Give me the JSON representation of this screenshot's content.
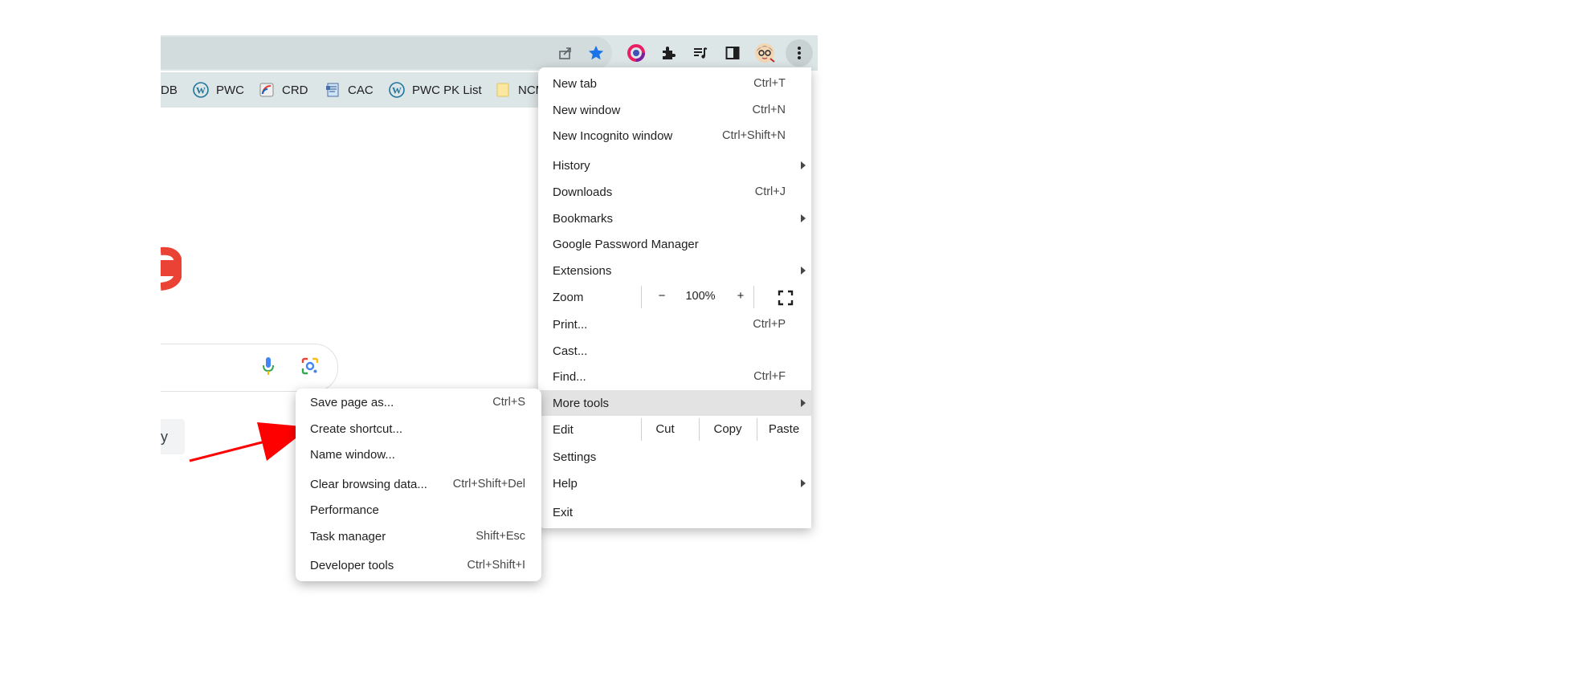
{
  "toolbar": {
    "icons": [
      "share-icon",
      "bookmark-star-icon",
      "color-extension-icon",
      "extensions-puzzle-icon",
      "reading-list-icon",
      "side-panel-icon",
      "profile-avatar",
      "kebab-menu-icon"
    ]
  },
  "bookmarks": [
    {
      "label": "DB",
      "icon": "none"
    },
    {
      "label": "PWC",
      "icon": "wordpress-icon"
    },
    {
      "label": "CRD",
      "icon": "rss-icon"
    },
    {
      "label": "CAC",
      "icon": "document-icon"
    },
    {
      "label": "PWC PK List",
      "icon": "wordpress-icon"
    },
    {
      "label": "NCM",
      "icon": "folder-icon"
    }
  ],
  "page": {
    "button_fragment": "y"
  },
  "menu": {
    "new_tab": {
      "label": "New tab",
      "shortcut": "Ctrl+T"
    },
    "new_window": {
      "label": "New window",
      "shortcut": "Ctrl+N"
    },
    "new_incognito": {
      "label": "New Incognito window",
      "shortcut": "Ctrl+Shift+N"
    },
    "history": {
      "label": "History"
    },
    "downloads": {
      "label": "Downloads",
      "shortcut": "Ctrl+J"
    },
    "bookmarks": {
      "label": "Bookmarks"
    },
    "password_manager": {
      "label": "Google Password Manager"
    },
    "extensions": {
      "label": "Extensions"
    },
    "zoom": {
      "label": "Zoom",
      "minus": "−",
      "value": "100%",
      "plus": "+"
    },
    "print": {
      "label": "Print...",
      "shortcut": "Ctrl+P"
    },
    "cast": {
      "label": "Cast..."
    },
    "find": {
      "label": "Find...",
      "shortcut": "Ctrl+F"
    },
    "more_tools": {
      "label": "More tools"
    },
    "edit": {
      "label": "Edit",
      "cut": "Cut",
      "copy": "Copy",
      "paste": "Paste"
    },
    "settings": {
      "label": "Settings"
    },
    "help": {
      "label": "Help"
    },
    "exit": {
      "label": "Exit"
    }
  },
  "submenu": {
    "save_page": {
      "label": "Save page as...",
      "shortcut": "Ctrl+S"
    },
    "create_shortcut": {
      "label": "Create shortcut..."
    },
    "name_window": {
      "label": "Name window..."
    },
    "clear_browsing": {
      "label": "Clear browsing data...",
      "shortcut": "Ctrl+Shift+Del"
    },
    "performance": {
      "label": "Performance"
    },
    "task_manager": {
      "label": "Task manager",
      "shortcut": "Shift+Esc"
    },
    "developer_tools": {
      "label": "Developer tools",
      "shortcut": "Ctrl+Shift+I"
    }
  },
  "colors": {
    "toolbar_bg": "#dde6e7",
    "star_blue": "#1a73e8",
    "arrow_red": "#ff0000",
    "highlight": "#e3e3e3"
  }
}
